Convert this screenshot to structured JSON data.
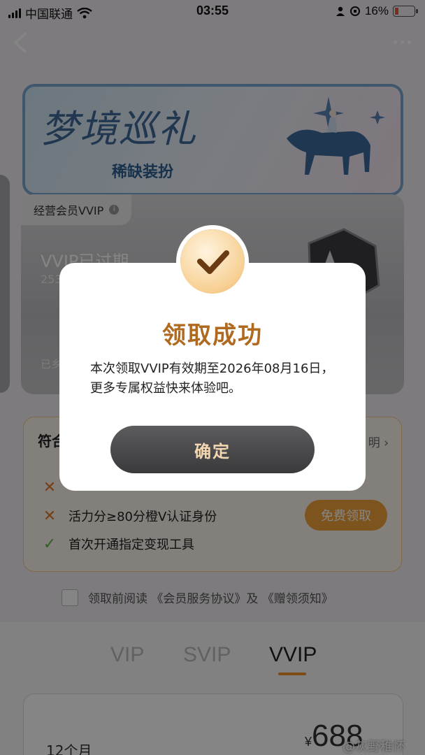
{
  "status_bar": {
    "carrier": "中国联通",
    "time": "03:55",
    "battery": "16%"
  },
  "banner": {
    "title": "梦境巡礼",
    "subtitle": "稀缺装扮"
  },
  "member_card": {
    "tag": "经营会员VVIP",
    "status": "VVIP已过期",
    "number": "253",
    "footer": "已乡"
  },
  "requirements": {
    "title": "符合",
    "link": "明",
    "items": [
      {
        "text": "",
        "met": false
      },
      {
        "text": "活力分≥80分橙V认证身份",
        "met": false
      },
      {
        "text": "首次开通指定变现工具",
        "met": true
      }
    ],
    "claim_button": "免费领取"
  },
  "agreement": {
    "text": "领取前阅读 《会员服务协议》及 《赠领须知》",
    "checked": false
  },
  "tabs": [
    {
      "label": "VIP",
      "active": false
    },
    {
      "label": "SVIP",
      "active": false
    },
    {
      "label": "VVIP",
      "active": true
    }
  ],
  "plan": {
    "name": "12个月",
    "currency": "¥",
    "price": "688"
  },
  "watermark": "@灰野稚怀",
  "dialog": {
    "title": "领取成功",
    "message_line1": "本次领取VVIP有效期至2026年08月16日，",
    "message_line2": "更多专属权益快来体验吧。",
    "confirm": "确定"
  },
  "colors": {
    "accent": "#f0a23a",
    "dialog_title": "#b06a20",
    "button_dark": "#4a4a4c",
    "battery_low": "#e53"
  }
}
